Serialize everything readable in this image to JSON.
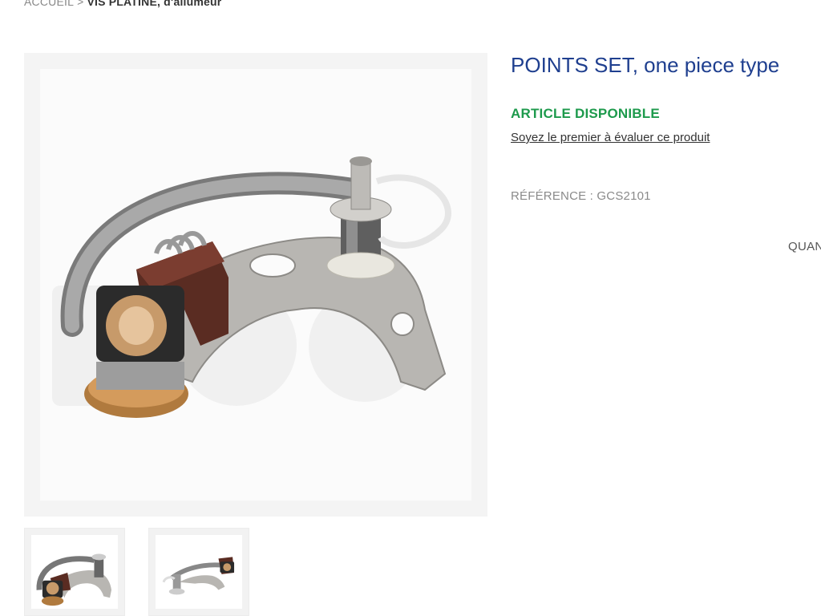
{
  "breadcrumb": {
    "home": "ACCUEIL",
    "separator": ">",
    "current_bold": "VIS PLATINE,",
    "current_rest": " d'allumeur"
  },
  "product": {
    "title": "POINTS SET, one piece type",
    "availability": "ARTICLE DISPONIBLE",
    "review_link": "Soyez le premier à évaluer ce produit",
    "reference_label": "RÉFÉRENCE : ",
    "reference_value": "GCS2101",
    "quantity_label": "QUANTITÉ"
  },
  "gallery": {
    "thumbnails": [
      "thumbnail-1",
      "thumbnail-2"
    ]
  },
  "colors": {
    "title_blue": "#1f3f8f",
    "available_green": "#1d9a4c",
    "muted_gray": "#8a8a8a"
  },
  "icons": {
    "product_image": "points-set-image"
  }
}
